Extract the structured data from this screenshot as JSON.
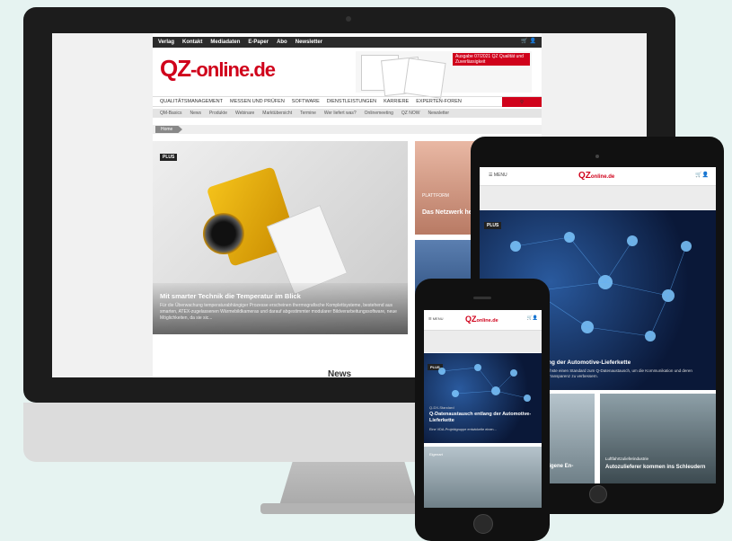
{
  "desktop": {
    "topbar": [
      "Verlag",
      "Kontakt",
      "Mediadaten",
      "E-Paper",
      "Abo",
      "Newsletter"
    ],
    "logo": {
      "qz": "QZ",
      "rest": "-online.de"
    },
    "banner": {
      "red": "Ausgabe 07/2021 QZ Qualität und Zuverlässigkeit"
    },
    "nav": [
      "QUALITÄTSMANAGEMENT",
      "MESSEN UND PRÜFEN",
      "SOFTWARE",
      "DIENSTLEISTUNGEN",
      "KARRIERE",
      "EXPERTEN-FOREN"
    ],
    "subnav": [
      "QM-Basics",
      "News",
      "Produkte",
      "Webinare",
      "Marktübersicht",
      "Termine",
      "Wer liefert was?",
      "Onlinemeeting",
      "QZ NOW",
      "Newsletter"
    ],
    "breadcrumb": "Home",
    "hero": {
      "badge": "PLUS",
      "title": "Mit smarter Technik die Temperatur im Blick",
      "text": "Für die Überwachung temperaturabhängiger Prozesse erscheinen thermografische Komplettsysteme, bestehend aus smarten, ATEX-zugelassenen Wärmebildkameras und darauf abgestimmter modularer Bildverarbeitungssoftware, neue Möglichkeiten, da sie sic..."
    },
    "side1": {
      "kicker": "PLATTFORM",
      "title": "Das Netzwerk heute geknüpft"
    },
    "news_heading": "News"
  },
  "tablet": {
    "menu": "MENU",
    "logo": {
      "qz": "QZ",
      "rest": "online.de"
    },
    "badge": "PLUS",
    "title": "ng der Automotive-Lieferkette",
    "text": "chste einen Standard zum Q-Datenaustausch, um die Kommunikation und deren Transparenz zu verbessern.",
    "card1": "eigene En-",
    "card2_kicker": "Luftfahrtzulieferindustrie",
    "card2": "Autozulieferer kommen ins Schleudern"
  },
  "phone": {
    "menu": "MENU",
    "logo": {
      "qz": "QZ",
      "rest": "online.de"
    },
    "badge": "PLUS",
    "kicker": "Q-DX-Standard",
    "title": "Q-Datenaustausch entlang der Automotive-Lieferkette",
    "text": "Eine VDA-Projektgruppe entwickelte einen...",
    "card_kicker": "Eigenart"
  },
  "colors": {
    "brand": "#d0021b",
    "dark": "#2b2b2b"
  },
  "icons": [
    "cart-icon",
    "user-icon",
    "search-icon",
    "menu-icon"
  ]
}
